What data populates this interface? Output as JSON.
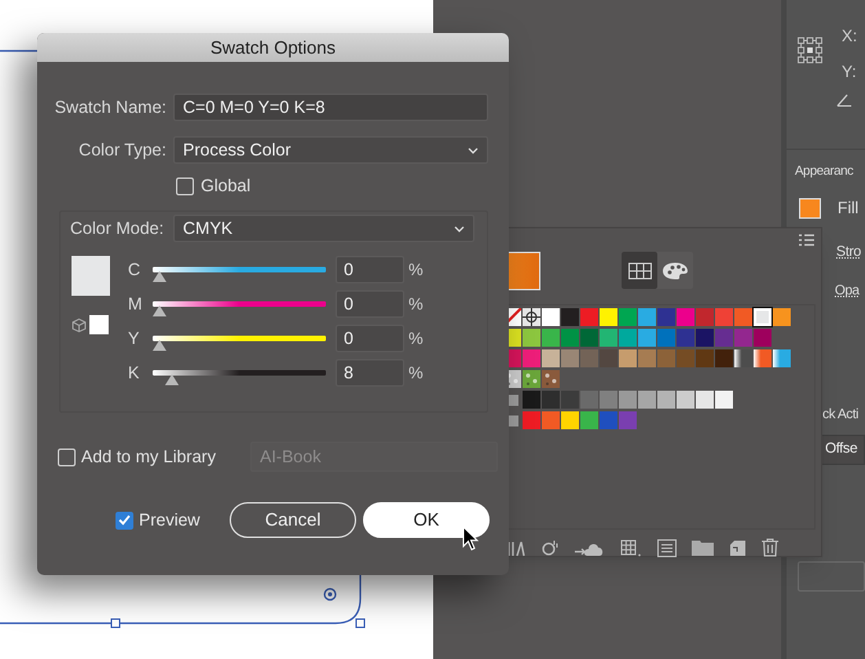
{
  "dialog": {
    "title": "Swatch Options",
    "swatch_name": {
      "label": "Swatch Name:",
      "value": "C=0 M=0 Y=0 K=8"
    },
    "color_type": {
      "label": "Color Type:",
      "value": "Process Color"
    },
    "global": {
      "label": "Global",
      "checked": false
    },
    "color_mode": {
      "label": "Color Mode:",
      "value": "CMYK"
    },
    "channels": [
      {
        "name": "C",
        "color": "#29abe2",
        "level": 0,
        "value": "0",
        "unit": "%"
      },
      {
        "name": "M",
        "color": "#ec008c",
        "level": 0,
        "value": "0",
        "unit": "%"
      },
      {
        "name": "Y",
        "color": "#fff200",
        "level": 0,
        "value": "0",
        "unit": "%"
      },
      {
        "name": "K",
        "color": "#231f20",
        "level": 0.08,
        "value": "8",
        "unit": "%"
      }
    ],
    "add_to_library": {
      "label": "Add to my Library",
      "checked": false
    },
    "library": {
      "value": "AI-Book",
      "disabled": true
    },
    "preview": {
      "label": "Preview",
      "checked": true
    },
    "buttons": [
      {
        "label": "Cancel",
        "kind": "secondary"
      },
      {
        "label": "OK",
        "kind": "primary"
      }
    ]
  },
  "swatches_panel": {
    "view_buttons": [
      {
        "kind": "grid",
        "selected": true
      },
      {
        "kind": "palette",
        "selected": false
      }
    ],
    "rows": [
      [
        {
          "kind": "none",
          "selected": false
        },
        {
          "kind": "registration",
          "selected": false
        },
        {
          "kind": "color",
          "color": "#ffffff",
          "selected": false
        },
        {
          "kind": "color",
          "color": "#231f20",
          "selected": false
        },
        {
          "kind": "color",
          "color": "#ed1c24",
          "selected": false
        },
        {
          "kind": "color",
          "color": "#fff200",
          "selected": false
        },
        {
          "kind": "color",
          "color": "#00a651",
          "selected": false
        },
        {
          "kind": "color",
          "color": "#29abe2",
          "selected": false
        },
        {
          "kind": "color",
          "color": "#2e3192",
          "selected": false
        },
        {
          "kind": "color",
          "color": "#ec008c",
          "selected": false
        },
        {
          "kind": "color",
          "color": "#c1272d",
          "selected": false
        },
        {
          "kind": "color",
          "color": "#ef4136",
          "selected": false
        },
        {
          "kind": "color",
          "color": "#f15a24",
          "selected": false
        },
        {
          "kind": "color",
          "color": "#e6e7e8",
          "selected": true
        },
        {
          "kind": "color",
          "color": "#f7931e",
          "selected": false
        }
      ],
      [
        {
          "kind": "color",
          "color": "#d9e021",
          "selected": false
        },
        {
          "kind": "color",
          "color": "#8cc63f",
          "selected": false
        },
        {
          "kind": "color",
          "color": "#39b54a",
          "selected": false
        },
        {
          "kind": "color",
          "color": "#009245",
          "selected": false
        },
        {
          "kind": "color",
          "color": "#006837",
          "selected": false
        },
        {
          "kind": "color",
          "color": "#22b573",
          "selected": false
        },
        {
          "kind": "color",
          "color": "#00a99d",
          "selected": false
        },
        {
          "kind": "color",
          "color": "#29abe2",
          "selected": false
        },
        {
          "kind": "color",
          "color": "#0071bc",
          "selected": false
        },
        {
          "kind": "color",
          "color": "#2e3192",
          "selected": false
        },
        {
          "kind": "color",
          "color": "#1b1464",
          "selected": false
        },
        {
          "kind": "color",
          "color": "#662d91",
          "selected": false
        },
        {
          "kind": "color",
          "color": "#93278f",
          "selected": false
        },
        {
          "kind": "color",
          "color": "#9e005d",
          "selected": false
        }
      ],
      [
        {
          "kind": "color",
          "color": "#d4145a",
          "selected": false
        },
        {
          "kind": "color",
          "color": "#ed1e79",
          "selected": false
        },
        {
          "kind": "color",
          "color": "#c7b299",
          "selected": false
        },
        {
          "kind": "color",
          "color": "#998675",
          "selected": false
        },
        {
          "kind": "color",
          "color": "#736357",
          "selected": false
        },
        {
          "kind": "color",
          "color": "#534741",
          "selected": false
        },
        {
          "kind": "color",
          "color": "#c69c6d",
          "selected": false
        },
        {
          "kind": "color",
          "color": "#a67c52",
          "selected": false
        },
        {
          "kind": "color",
          "color": "#8c6239",
          "selected": false
        },
        {
          "kind": "color",
          "color": "#754c24",
          "selected": false
        },
        {
          "kind": "color",
          "color": "#603813",
          "selected": false
        },
        {
          "kind": "color",
          "color": "#42210b",
          "selected": false
        },
        {
          "kind": "gradient",
          "color": "#4d4d4d",
          "selected": false
        },
        {
          "kind": "gradient",
          "color": "#f15a24",
          "selected": false
        },
        {
          "kind": "gradient",
          "color": "#29abe2",
          "selected": false
        }
      ],
      [
        {
          "kind": "pattern",
          "color": "#c8c8c8",
          "selected": false
        },
        {
          "kind": "pattern",
          "color": "#6aa53a",
          "selected": false
        },
        {
          "kind": "pattern",
          "color": "#8a5a3c",
          "selected": false
        }
      ],
      [
        {
          "kind": "group",
          "selected": false
        },
        {
          "kind": "color",
          "color": "#1a1a1a",
          "selected": false
        },
        {
          "kind": "color",
          "color": "#2e2e2e",
          "selected": false
        },
        {
          "kind": "color",
          "color": "#3c3c3c",
          "selected": false
        },
        {
          "kind": "color",
          "color": "#6a6a6a",
          "selected": false
        },
        {
          "kind": "color",
          "color": "#808080",
          "selected": false
        },
        {
          "kind": "color",
          "color": "#999999",
          "selected": false
        },
        {
          "kind": "color",
          "color": "#a6a6a6",
          "selected": false
        },
        {
          "kind": "color",
          "color": "#b3b3b3",
          "selected": false
        },
        {
          "kind": "color",
          "color": "#cccccc",
          "selected": false
        },
        {
          "kind": "color",
          "color": "#e6e6e6",
          "selected": false
        },
        {
          "kind": "color",
          "color": "#f2f2f2",
          "selected": false
        }
      ],
      [
        {
          "kind": "group",
          "selected": false
        },
        {
          "kind": "color",
          "color": "#ed1c24",
          "selected": false
        },
        {
          "kind": "color",
          "color": "#f15a24",
          "selected": false
        },
        {
          "kind": "color",
          "color": "#ffd400",
          "selected": false
        },
        {
          "kind": "color",
          "color": "#39b54a",
          "selected": false
        },
        {
          "kind": "color",
          "color": "#1f4fbf",
          "selected": false
        },
        {
          "kind": "color",
          "color": "#7a3fb0",
          "selected": false
        }
      ]
    ]
  },
  "properties_panel": {
    "x_label": "X:",
    "y_label": "Y:",
    "appearance_title": "Appearanc",
    "fill_label": "Fill",
    "stroke_label": "Stro",
    "opacity_label": "Opa",
    "quick_actions_title": "ck Acti",
    "offset_button": "Offse"
  }
}
